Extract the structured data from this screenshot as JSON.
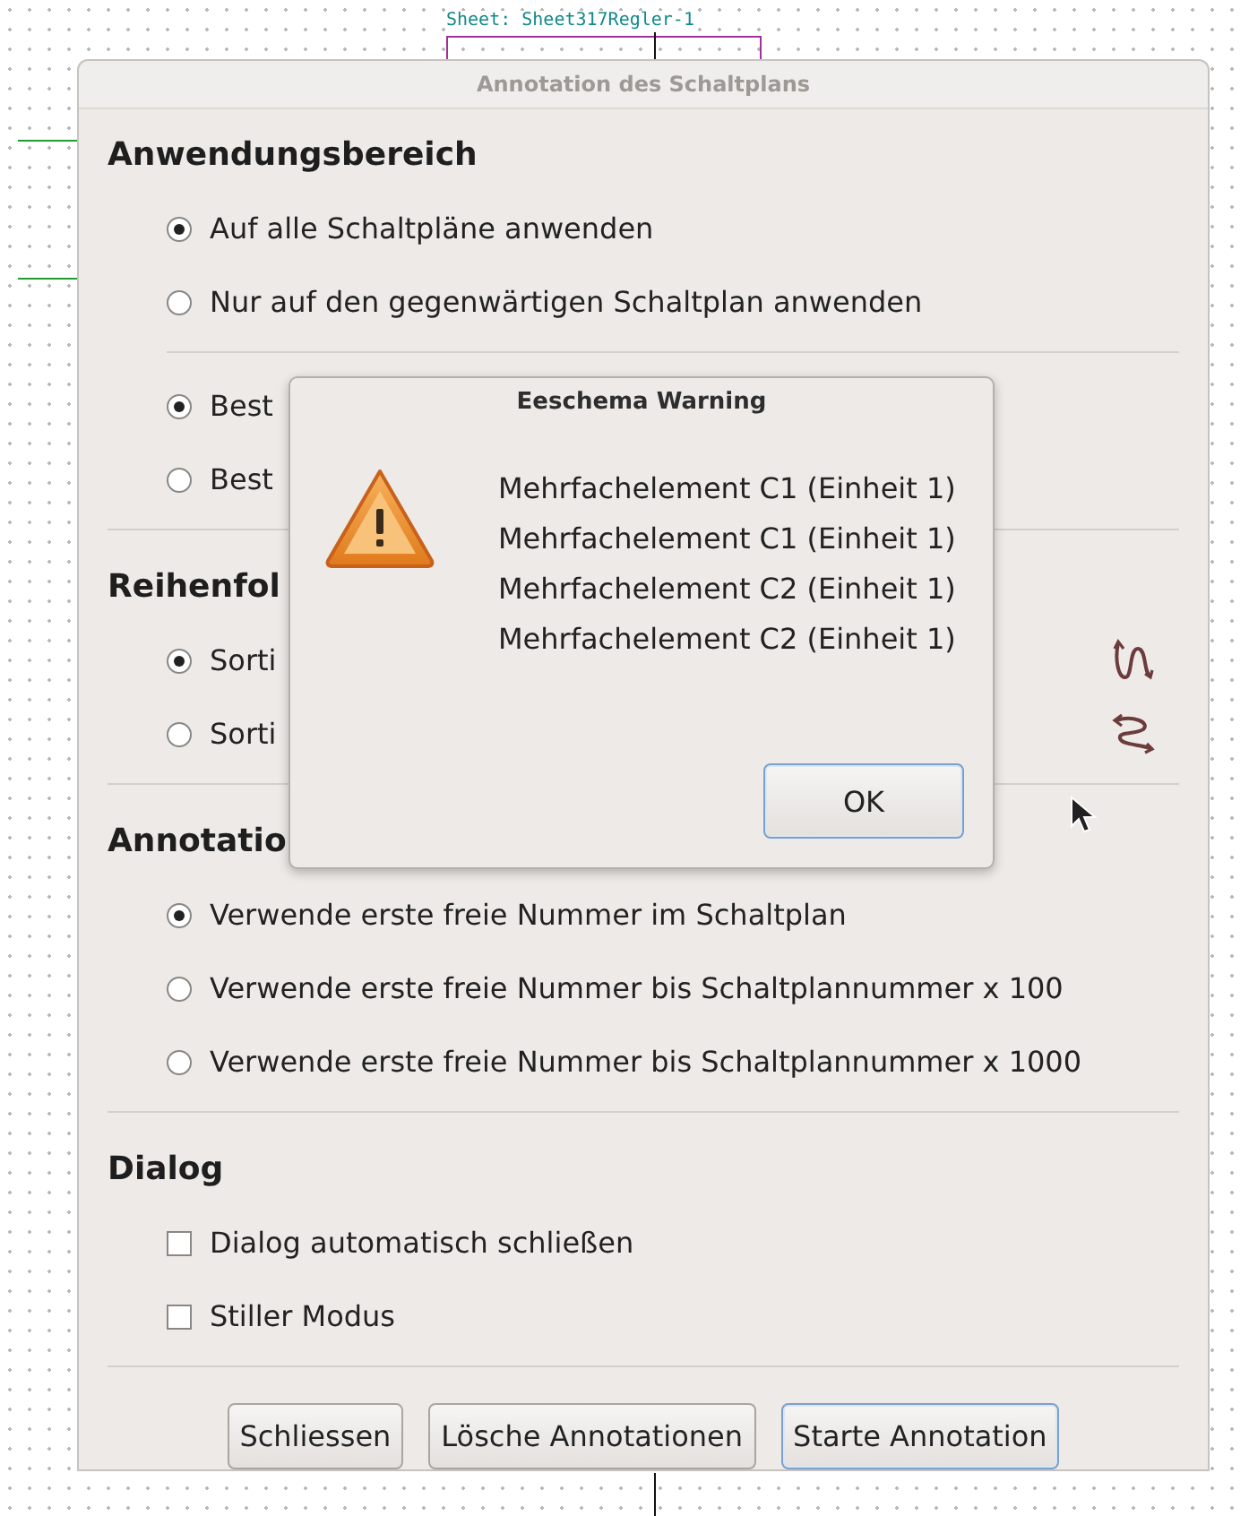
{
  "canvas": {
    "sheet_label": "Sheet: Sheet317Regler-1"
  },
  "dialog": {
    "title": "Annotation des Schaltplans",
    "sections": [
      {
        "heading": "Anwendungsbereich",
        "kind": "plain",
        "groups": [
          {
            "kind": "radio",
            "options": [
              {
                "label": "Auf alle Schaltpläne anwenden",
                "selected": true
              },
              {
                "label": "Nur auf den gegenwärtigen Schaltplan anwenden",
                "selected": false
              }
            ]
          },
          {
            "kind": "radio",
            "options": [
              {
                "label": "Best",
                "selected": true
              },
              {
                "label": "Best",
                "selected": false
              }
            ]
          }
        ]
      },
      {
        "heading": "Reihenfol",
        "kind": "sort",
        "groups": [
          {
            "kind": "radio",
            "options": [
              {
                "label": "Sorti",
                "selected": true
              },
              {
                "label": "Sorti",
                "selected": false
              }
            ]
          }
        ]
      },
      {
        "heading": "Annotatio",
        "kind": "plain",
        "groups": [
          {
            "kind": "radio",
            "options": [
              {
                "label": "Verwende erste freie Nummer im Schaltplan",
                "selected": true
              },
              {
                "label": "Verwende erste freie Nummer bis Schaltplannummer x 100",
                "selected": false
              },
              {
                "label": "Verwende erste freie Nummer bis Schaltplannummer x 1000",
                "selected": false
              }
            ]
          }
        ]
      },
      {
        "heading": "Dialog",
        "kind": "plain",
        "groups": [
          {
            "kind": "checkbox",
            "options": [
              {
                "label": "Dialog automatisch schließen",
                "checked": false
              },
              {
                "label": "Stiller Modus",
                "checked": false
              }
            ]
          }
        ]
      }
    ],
    "buttons": [
      {
        "label": "Schliessen",
        "default": false
      },
      {
        "label": "Lösche Annotationen",
        "default": false
      },
      {
        "label": "Starte Annotation",
        "default": true
      }
    ]
  },
  "warning": {
    "title": "Eeschema Warning",
    "messages": [
      "Mehrfachelement C1 (Einheit 1)",
      "Mehrfachelement C1 (Einheit 1)",
      "Mehrfachelement C2 (Einheit 1)",
      "Mehrfachelement C2 (Einheit 1)"
    ],
    "button": {
      "label": "OK",
      "default": true
    }
  }
}
